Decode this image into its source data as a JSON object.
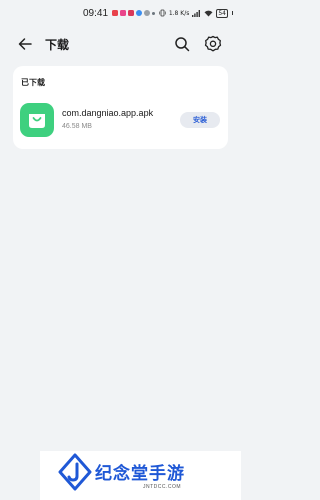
{
  "status_bar": {
    "time": "09:41",
    "network": "1.8 K/s",
    "battery": "54",
    "app_icons": [
      {
        "name": "app-red-icon",
        "color": "#e8414b"
      },
      {
        "name": "app-pink-icon",
        "color": "#e9448a"
      },
      {
        "name": "app-rose-icon",
        "color": "#d9385a"
      },
      {
        "name": "app-blue-icon",
        "color": "#3b8ef0"
      },
      {
        "name": "app-gray-icon",
        "color": "#9aa0a6"
      },
      {
        "name": "app-dot-icon",
        "color": "#6c757d"
      }
    ]
  },
  "header": {
    "title": "下载",
    "icons": [
      "back-arrow-icon",
      "search-icon",
      "gear-icon"
    ]
  },
  "downloads": {
    "section_title": "已下载",
    "items": [
      {
        "file_name": "com.dangniao.app.apk",
        "file_size": "46.58 MB",
        "action_label": "安装",
        "icon": "shopping-bag-icon",
        "icon_color": "#3ed07f"
      }
    ]
  },
  "watermark": {
    "text": "纪念堂手游",
    "sub": "JNTDCC.COM",
    "accent": "#1f58d6"
  },
  "colors": {
    "background": "#f1f3f5",
    "card": "#ffffff",
    "install_button_bg": "#e7eaf0",
    "install_button_text": "#2c5fd6"
  }
}
